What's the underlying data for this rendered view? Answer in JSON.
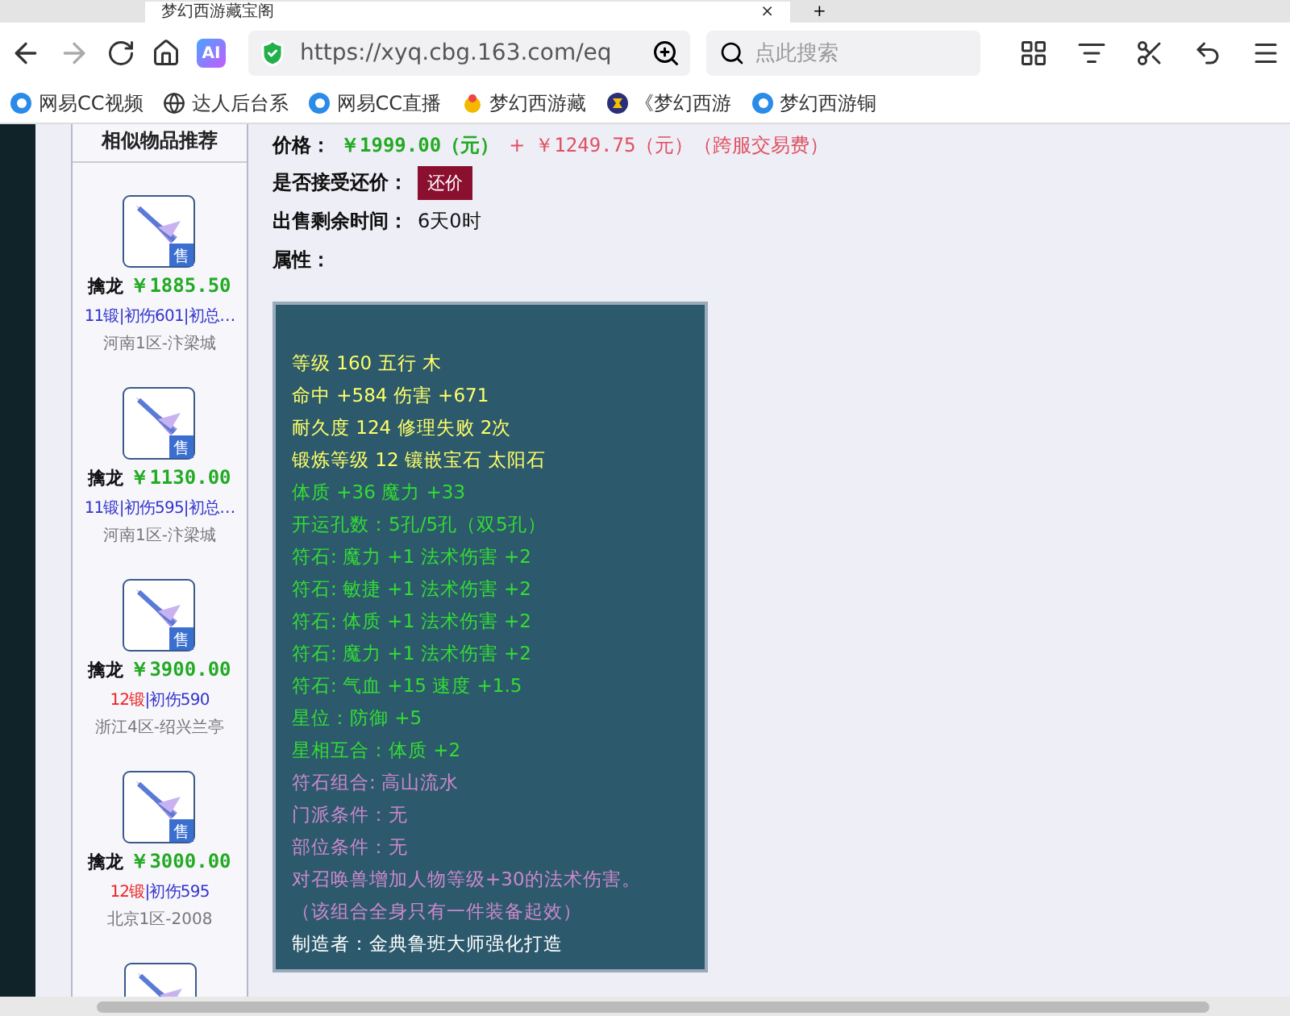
{
  "tab": {
    "title": "梦幻西游藏宝阁",
    "close": "×",
    "new_tab": "+"
  },
  "toolbar": {
    "url": "https://xyq.cbg.163.com/eq",
    "search": {
      "placeholder": "点此搜索"
    },
    "ai": "AI"
  },
  "bookmarks": [
    {
      "label": "网易CC视频",
      "kind": "cc"
    },
    {
      "label": "达人后台系",
      "kind": "globe"
    },
    {
      "label": "网易CC直播",
      "kind": "cc"
    },
    {
      "label": "梦幻西游藏",
      "kind": "chick"
    },
    {
      "label": "《梦幻西游",
      "kind": "badge"
    },
    {
      "label": "梦幻西游铜",
      "kind": "cc"
    }
  ],
  "sidebar": {
    "title": "相似物品推荐",
    "items": [
      {
        "name": "擒龙",
        "price": "￥1885.50",
        "level": "11锻",
        "color": "#3333cc",
        "details": "|初伤601|初总…",
        "server": "河南1区-汴梁城",
        "badge": "售"
      },
      {
        "name": "擒龙",
        "price": "￥1130.00",
        "level": "11锻",
        "color": "#3333cc",
        "details": "|初伤595|初总…",
        "server": "河南1区-汴梁城",
        "badge": "售"
      },
      {
        "name": "擒龙",
        "price": "￥3900.00",
        "level": "12锻",
        "color": "#ee2222",
        "details": "|初伤590",
        "server": "浙江4区-绍兴兰亭",
        "badge": "售"
      },
      {
        "name": "擒龙",
        "price": "￥3000.00",
        "level": "12锻",
        "color": "#ee2222",
        "details": "|初伤595",
        "server": "北京1区-2008",
        "badge": "售"
      }
    ]
  },
  "details": {
    "price_label": "价格：",
    "price": "￥1999.00（元）",
    "plus": "+",
    "fee": "￥1249.75（元）（跨服交易费）",
    "bargain_label": "是否接受还价：",
    "bargain_button": "还价",
    "time_label": "出售剩余时间：",
    "time": "6天0时",
    "attr_label": "属性："
  },
  "attributes": [
    {
      "text": "等级 160 五行 木",
      "color": "#ffff66"
    },
    {
      "text": "命中 +584 伤害 +671",
      "color": "#ffff66"
    },
    {
      "text": "耐久度 124 修理失败 2次",
      "color": "#ffff66"
    },
    {
      "text": "锻炼等级 12 镶嵌宝石 太阳石",
      "color": "#ffff66"
    },
    {
      "text": "体质 +36 魔力 +33",
      "color": "#33dd33"
    },
    {
      "text": "开运孔数：5孔/5孔（双5孔）",
      "color": "#33dd33"
    },
    {
      "text": "符石: 魔力 +1 法术伤害 +2",
      "color": "#33dd33"
    },
    {
      "text": "符石: 敏捷 +1 法术伤害 +2",
      "color": "#33dd33"
    },
    {
      "text": "符石: 体质 +1 法术伤害 +2",
      "color": "#33dd33"
    },
    {
      "text": "符石: 魔力 +1 法术伤害 +2",
      "color": "#33dd33"
    },
    {
      "text": "符石: 气血 +15 速度 +1.5",
      "color": "#33dd33"
    },
    {
      "text": "星位：防御 +5",
      "color": "#33dd33"
    },
    {
      "text": "星相互合：体质 +2",
      "color": "#33dd33"
    },
    {
      "text": "符石组合: 高山流水",
      "color": "#cc88cc"
    },
    {
      "text": "门派条件：无",
      "color": "#cc88cc"
    },
    {
      "text": "部位条件：无",
      "color": "#cc88cc"
    },
    {
      "text": "对召唤兽增加人物等级+30的法术伤害。",
      "color": "#cc88cc"
    },
    {
      "text": "（该组合全身只有一件装备起效）",
      "color": "#cc88cc"
    },
    {
      "text": "制造者：金典鲁班大师强化打造",
      "color": "#ffffff"
    }
  ]
}
